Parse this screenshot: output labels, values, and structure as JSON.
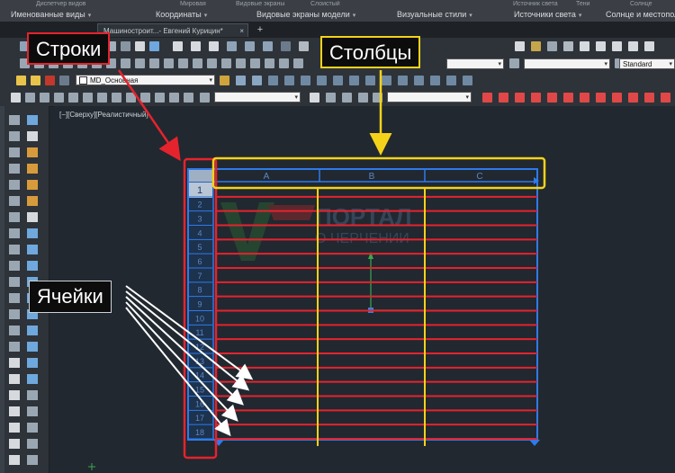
{
  "ribbon": {
    "top_row": [
      "Диспетчер видов",
      "Мировая",
      "Видовые экраны",
      "Слоистый",
      "Источник света",
      "Тени",
      "Солнце"
    ],
    "panels": [
      {
        "label": "Именованные виды"
      },
      {
        "label": "Координаты"
      },
      {
        "label": "Видовые экраны модели"
      },
      {
        "label": "Визуальные стили"
      },
      {
        "label": "Источники света"
      },
      {
        "label": "Солнце и местопол"
      }
    ]
  },
  "tabs": {
    "file_tab_label": "Машиностроит...- Евгений Курицин*",
    "close_glyph": "×",
    "add_glyph": "+"
  },
  "toolbar": {
    "standard_style": "Standard",
    "layer_name": "MD_Основная"
  },
  "viewport": {
    "label": "[−][Сверху][Реалистичный]"
  },
  "table": {
    "columns": [
      "A",
      "B",
      "C"
    ],
    "rows": [
      "1",
      "2",
      "3",
      "4",
      "5",
      "6",
      "7",
      "8",
      "9",
      "10",
      "11",
      "12",
      "13",
      "14",
      "15",
      "16",
      "17",
      "18"
    ]
  },
  "annotations": {
    "rows": "Строки",
    "columns": "Столбцы",
    "cells": "Ячейки"
  },
  "watermark": {
    "line1": "ПОРТАЛ",
    "line2": "О ЧЕРЧЕНИИ"
  },
  "colors": {
    "accent_red": "#e5232d",
    "accent_yellow": "#f5d21a",
    "table_blue": "#2f7bea",
    "canvas_bg": "#212830"
  }
}
